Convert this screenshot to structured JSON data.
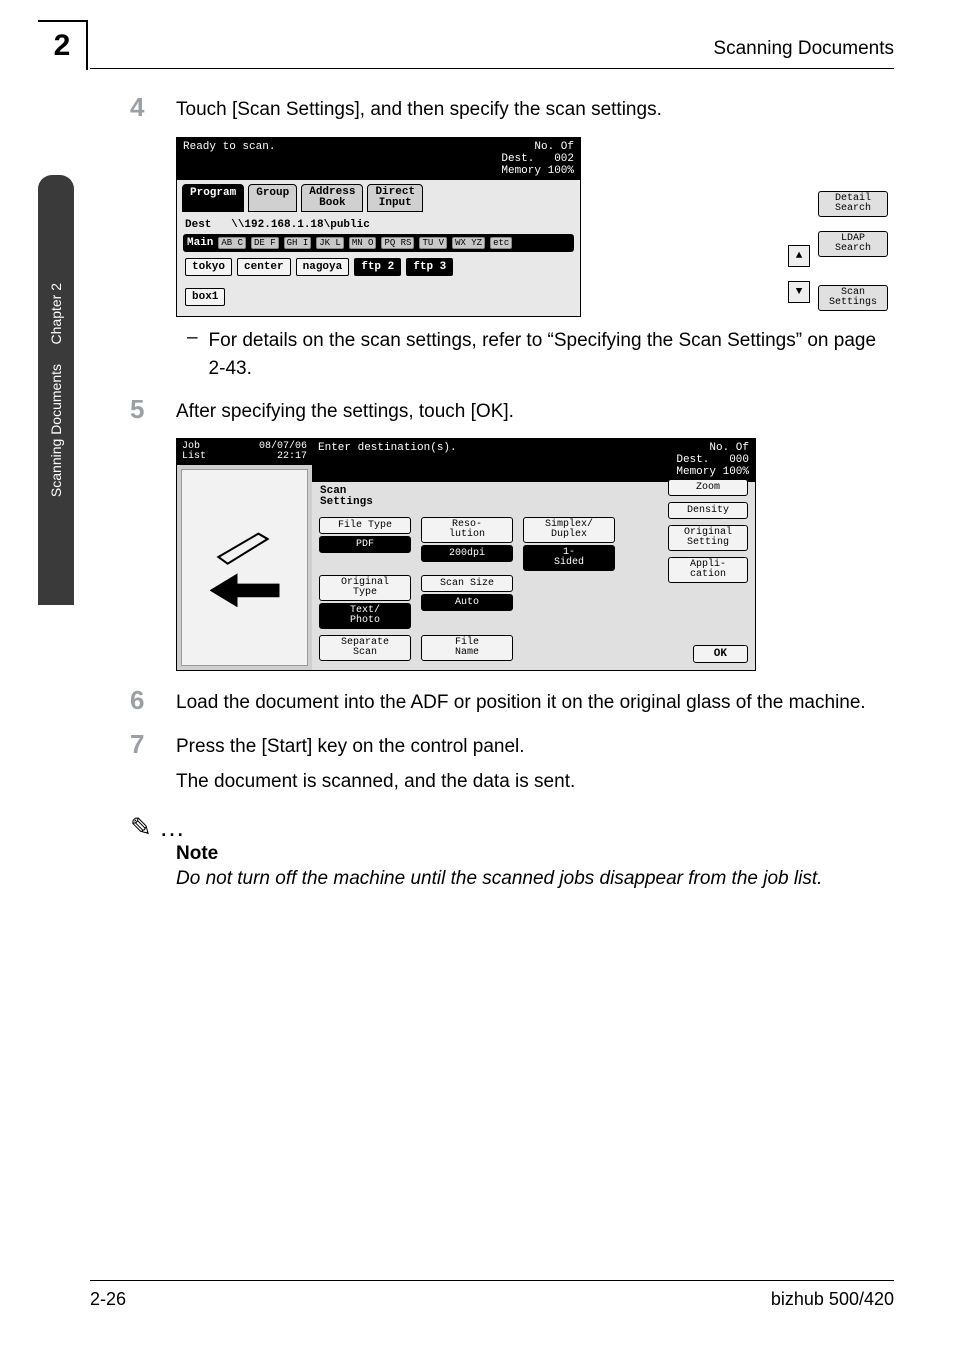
{
  "header": {
    "page_chapter_num": "2",
    "title_right": "Scanning Documents"
  },
  "sidebar": {
    "top": "Chapter 2",
    "bottom": "Scanning Documents"
  },
  "steps": {
    "s4": {
      "num": "4",
      "text": "Touch [Scan Settings], and then specify the scan settings.",
      "dash": "For details on the scan settings, refer to “Specifying the Scan Settings” on page 2-43."
    },
    "s5": {
      "num": "5",
      "text": "After specifying the settings, touch [OK]."
    },
    "s6": {
      "num": "6",
      "text": "Load the document into the ADF or position it on the original glass of the machine."
    },
    "s7": {
      "num": "7",
      "text": "Press the [Start] key on the control panel.",
      "after": "The document is scanned, and the data is sent."
    }
  },
  "note": {
    "icon": "✎ …",
    "head": "Note",
    "body": "Do not turn off the machine until the scanned jobs disappear from the job list."
  },
  "footer": {
    "left": "2-26",
    "right": "bizhub 500/420"
  },
  "scr1": {
    "ready": "Ready to scan.",
    "noof_label": "No. Of\nDest.",
    "noof_val": "002",
    "mem_label": "Memory",
    "mem_val": "100%",
    "tabs": {
      "program": "Program",
      "group": "Group",
      "address": "Address\nBook",
      "direct": "Direct\nInput"
    },
    "dest_label": "Dest",
    "dest_value": "\\\\192.168.1.18\\public",
    "main": "Main",
    "glyphs": [
      "AB C",
      "DE F",
      "GH I",
      "JK L",
      "MN O",
      "PQ RS",
      "TU V",
      "WX YZ",
      "etc"
    ],
    "items": {
      "tokyo": "tokyo",
      "center": "center",
      "nagoya": "nagoya",
      "ftp2": "ftp 2",
      "ftp3": "ftp 3",
      "box1": "box1"
    },
    "right_buttons": {
      "detail": "Detail\nSearch",
      "ldap": "LDAP\nSearch",
      "scan": "Scan\nSettings"
    },
    "arrows": {
      "up": "▲",
      "down": "▼"
    }
  },
  "scr2": {
    "job_label": "Job\nList",
    "datetime": "08/07/06\n22:17",
    "enter": "Enter destination(s).",
    "noof_label": "No. Of\nDest.",
    "noof_val": "000",
    "mem_label": "Memory",
    "mem_val": "100%",
    "section": "Scan\nSettings",
    "row1": {
      "filetype_lbl": "File Type",
      "filetype_val": "PDF",
      "reso_lbl": "Reso-\nlution",
      "reso_val": "200dpi",
      "simplex_lbl": "Simplex/\nDuplex",
      "simplex_val": "1-\nSided"
    },
    "row2": {
      "orig_lbl": "Original\nType",
      "orig_val": "Text/\nPhoto",
      "size_lbl": "Scan Size",
      "size_val": "Auto"
    },
    "row3": {
      "sep": "Separate\nScan",
      "file": "File\nName"
    },
    "side": {
      "zoom": "Zoom",
      "density": "Density",
      "orig": "Original\nSetting",
      "appli": "Appli-\ncation"
    },
    "ok": "OK"
  }
}
